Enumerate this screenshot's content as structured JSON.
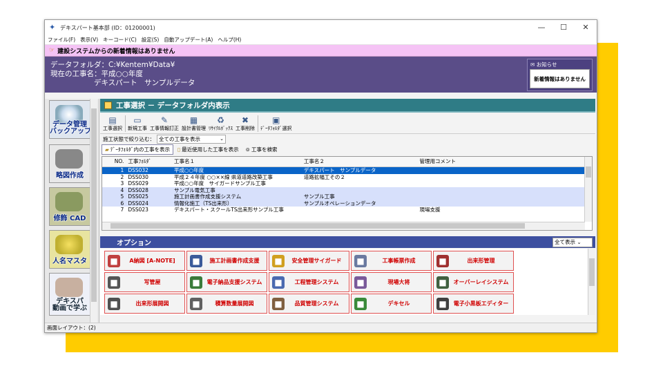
{
  "window": {
    "title": "デキスパート基本部 (ID：01200001)",
    "minimize": "—",
    "maximize": "☐",
    "close": "✕"
  },
  "menu": [
    "ファイル(F)",
    "表示(V)",
    "キーコード(C)",
    "設定(S)",
    "自動アップデート(A)",
    "ヘルプ(H)"
  ],
  "notice": {
    "text": "建設システムからの新着情報はありません"
  },
  "header": {
    "folder_line": "データフォルダ：C:¥Kentem¥Data¥",
    "project_line1": "現在の工事名：平成○○年度",
    "project_line2": "　　　　　　デキスパート　サンプルデータ",
    "news_title": "お知らせ",
    "news_body": "新着情報はありません"
  },
  "left_tiles": [
    "データ管理\nバックアップ",
    "略図作成",
    "修飾 CAD",
    "人名マスタ",
    "デキスパ\n動画で学ぶ"
  ],
  "section_title": "工事選択 － データフォルダ内表示",
  "toolbar": [
    "工事選択",
    "新規工事",
    "工事情報訂正",
    "設計書管理",
    "ﾘｻｲｸﾙﾎﾞｯｸｽ",
    "工事削除",
    "ﾃﾞｰﾀﾌｫﾙﾀﾞ選択"
  ],
  "filter": {
    "label": "施工状態で絞り込む：",
    "value": "全ての工事を表示"
  },
  "tabs": [
    "ﾃﾞｰﾀﾌｫﾙﾀﾞ内の工事を表示",
    "最近使用した工事を表示",
    "工事を検索"
  ],
  "table": {
    "columns": [
      "NO.",
      "工事ﾌｫﾙﾀﾞ",
      "工事名１",
      "工事名２",
      "管理用コメント"
    ],
    "rows": [
      [
        "1",
        "DSS032",
        "平成○○年度",
        "デキスパート　サンプルデータ",
        ""
      ],
      [
        "2",
        "DSS030",
        "平成２４年度 ○○××線 県道道路改築工事",
        "道路拡幅工その２",
        ""
      ],
      [
        "3",
        "DSS029",
        "平成○○年度　サイガードサンプル工事",
        "",
        ""
      ],
      [
        "4",
        "DSS028",
        "サンプル電気工事",
        "",
        ""
      ],
      [
        "5",
        "DSS025",
        "施工計画書作成支援システム",
        "サンプル工事",
        ""
      ],
      [
        "6",
        "DSS024",
        "情報化施工（TS出来形）",
        "サンプルオペレーションデータ",
        ""
      ],
      [
        "7",
        "DSS023",
        "デキスパート・スクールTS出来形サンプル工事",
        "",
        "現場支援"
      ]
    ]
  },
  "options": {
    "title": "オプション",
    "filter": "全て表示",
    "buttons": [
      "A納図 [A-NOTE]",
      "施工計画書作成支援",
      "安全管理サイガード",
      "工事帳票作成",
      "出来形管理",
      "写管屋",
      "電子納品支援システム",
      "工程管理システム",
      "現場大将",
      "オーバーレイシステム",
      "出来形展開図",
      "積算数量展開図",
      "品質管理システム",
      "デキセル",
      "電子小黒板エディター"
    ],
    "icon_colors": [
      "#c04040",
      "#3a5a9a",
      "#d0a020",
      "#6a7aa0",
      "#a03030",
      "#555555",
      "#3a7a3a",
      "#4a6ab0",
      "#7a5a9a",
      "#406040",
      "#505050",
      "#606060",
      "#806040",
      "#3a8a3a",
      "#404040"
    ]
  },
  "status": {
    "text": "画面レイアウト：(2)"
  }
}
